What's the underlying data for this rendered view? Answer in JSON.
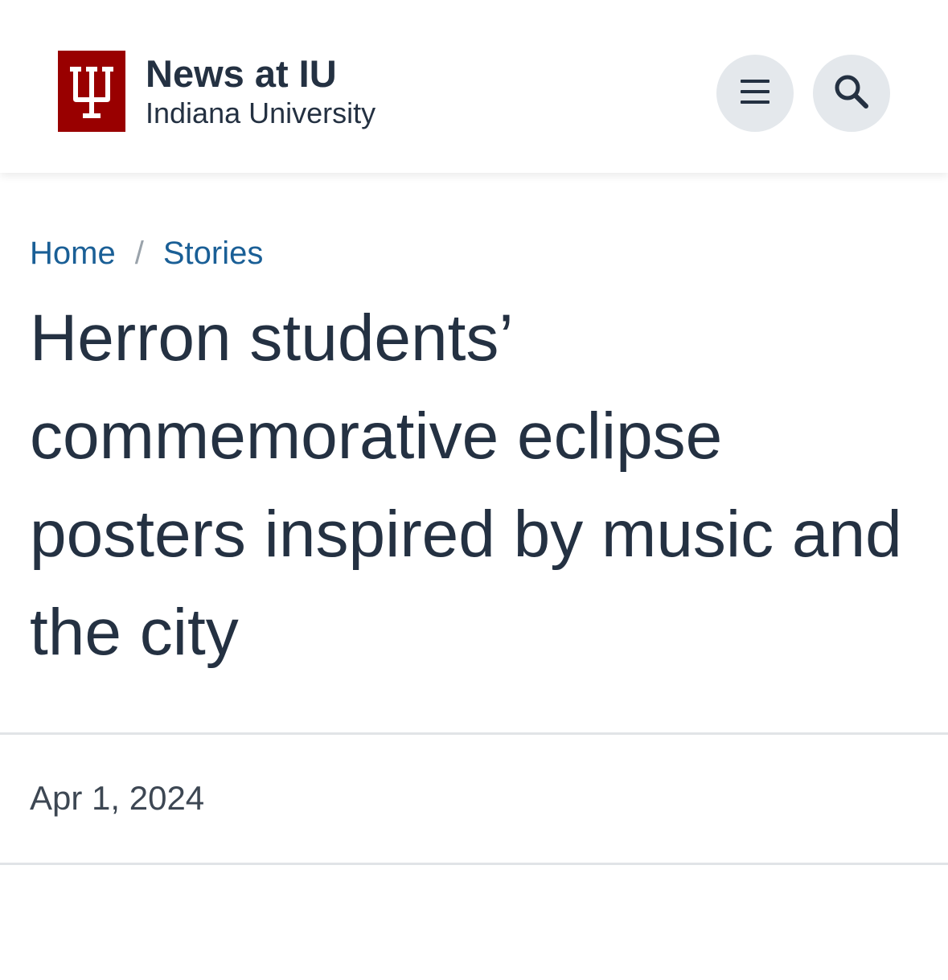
{
  "site": {
    "title": "News at IU",
    "subtitle": "Indiana University",
    "logo_icon": "iu-trident-logo",
    "brand_color": "#990000"
  },
  "header": {
    "menu_icon": "hamburger-menu-icon",
    "search_icon": "search-icon"
  },
  "breadcrumb": {
    "items": [
      "Home",
      "Stories"
    ],
    "separator": "/"
  },
  "article": {
    "title": "Herron students’ commemorative eclipse posters inspired by music and the city",
    "date": "Apr 1, 2024"
  }
}
